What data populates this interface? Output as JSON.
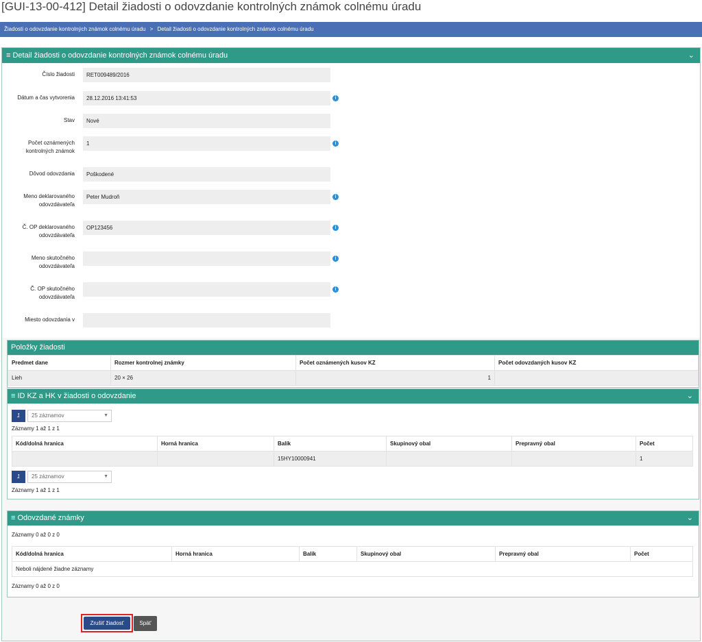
{
  "title": "[GUI-13-00-412] Detail žiadosti o odovzdanie kontrolných známok colnému úradu",
  "breadcrumb": [
    "Žiadosti o odovzdanie kontrolných známok colnému úradu",
    ">",
    "Detail žiadosti o odovzdanie kontrolných známok colnému úradu"
  ],
  "main_panel": {
    "title": "≡ Detail žiadosti o odovzdanie kontrolných známok colnému úradu",
    "chevron": "chevron-down-icon"
  },
  "form": {
    "cislo_label": "Číslo žiadosti",
    "cislo_value": "RET009489/2016",
    "datum_label": "Dátum a čas vytvorenia",
    "datum_value": "28.12.2016 13:41:53",
    "stav_label": "Stav",
    "stav_value": "Nové",
    "pocet_label_1": "Počet oznámených",
    "pocet_label_2": "kontrolných známok",
    "pocet_value": "1",
    "dovod_label": "Dôvod odovzdania",
    "dovod_value": "Poškodené",
    "meno_dekl_label_1": "Meno deklarovaného",
    "meno_dekl_label_2": "odovzdávateľa",
    "meno_dekl_value": "Peter Mudroň",
    "op_dekl_label_1": "Č. OP deklarovaného",
    "op_dekl_label_2": "odovzdávateľa",
    "op_dekl_value": "OP123456",
    "meno_skut_label_1": "Meno skutočného",
    "meno_skut_label_2": "odovzdávateľa",
    "meno_skut_value": "",
    "op_skut_label_1": "Č. OP skutočného",
    "op_skut_label_2": "odovzdávateľa",
    "op_skut_value": "",
    "miesto_label": "Miesto odovzdania v",
    "miesto_value": "",
    "info_glyph": "i"
  },
  "polozky": {
    "title": "Položky žiadosti",
    "headers": [
      "Predmet dane",
      "Rozmer kontrolnej známky",
      "Počet oznámených kusov KZ",
      "Počet odovzdaných kusov KZ"
    ],
    "row": [
      "Lieh",
      "20 × 26",
      "1",
      ""
    ]
  },
  "id_kz": {
    "title": "≡ ID KZ a HK v žiadosti o odovzdanie",
    "page": "1",
    "page_size": "25 záznamov",
    "count_text": "Záznamy 1 až 1 z 1",
    "headers": [
      "Kód/dolná hranica",
      "Horná hranica",
      "Balík",
      "Skupinový obal",
      "Prepravný obal",
      "Počet"
    ],
    "row": [
      "",
      "",
      "15HY10000941",
      "",
      "",
      "1"
    ]
  },
  "odovzdane": {
    "title": "≡ Odovzdané známky",
    "count_text": "Záznamy 0 až 0 z 0",
    "headers": [
      "Kód/dolná hranica",
      "Horná hranica",
      "Balík",
      "Skupinový obal",
      "Prepravný obal",
      "Počet"
    ],
    "empty_text": "Neboli nájdené žiadne záznamy"
  },
  "buttons": {
    "cancel": "Zrušiť žiadosť",
    "back": "Späť"
  }
}
